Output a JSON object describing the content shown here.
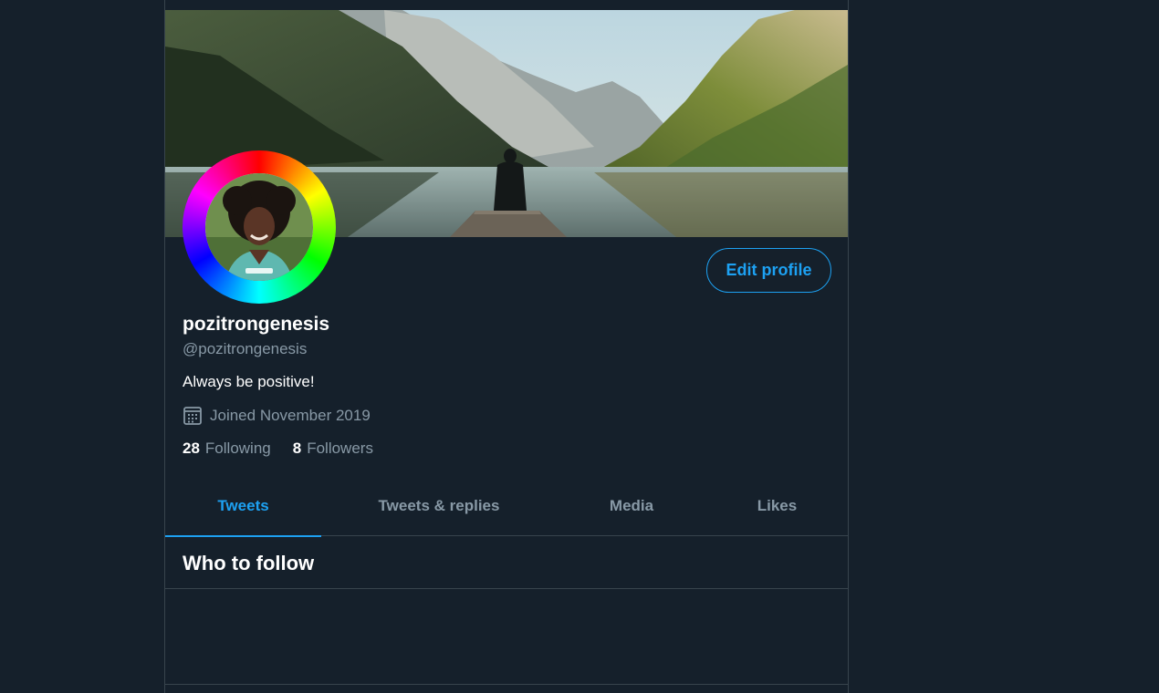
{
  "profile": {
    "display_name": "pozitrongenesis",
    "handle": "@pozitrongenesis",
    "bio": "Always be positive!",
    "joined": "Joined November 2019",
    "edit_label": "Edit profile",
    "following_count": "28",
    "following_label": "Following",
    "followers_count": "8",
    "followers_label": "Followers"
  },
  "tabs": [
    {
      "label": "Tweets",
      "active": true
    },
    {
      "label": "Tweets & replies",
      "active": false
    },
    {
      "label": "Media",
      "active": false
    },
    {
      "label": "Likes",
      "active": false
    }
  ],
  "who_to_follow": {
    "title": "Who to follow"
  },
  "colors": {
    "background": "#15202b",
    "accent": "#1da1f2",
    "secondary_text": "#8899a6",
    "border": "#38444d"
  },
  "icons": {
    "calendar": "calendar-icon"
  }
}
